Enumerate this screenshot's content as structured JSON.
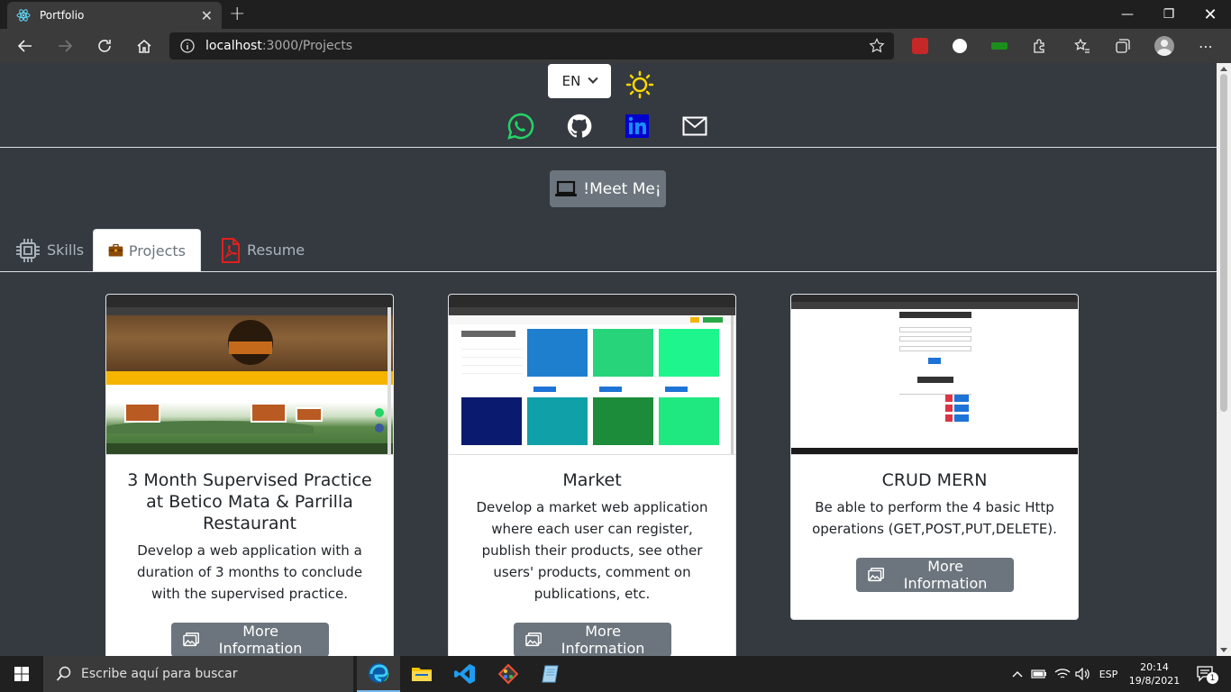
{
  "browser": {
    "tab_title": "Portfolio",
    "url_host": "localhost",
    "url_path": ":3000/Projects"
  },
  "header": {
    "language": "EN",
    "social": [
      "whatsapp-icon",
      "github-icon",
      "linkedin-icon",
      "mail-icon"
    ]
  },
  "meet_button": "!Meet Me¡",
  "tabs": [
    {
      "label": "Skills",
      "icon": "chip-icon"
    },
    {
      "label": "Projects",
      "icon": "briefcase-icon"
    },
    {
      "label": "Resume",
      "icon": "pdf-icon"
    }
  ],
  "projects": [
    {
      "title": "3 Month Supervised Practice at Betico Mata & Parrilla Restaurant",
      "description": "Develop a web application with a duration of 3 months to conclude with the supervised practice.",
      "button": "More Information"
    },
    {
      "title": "Market",
      "description": "Develop a market web application where each user can register, publish their products, see other users' products, comment on publications, etc.",
      "button": "More Information"
    },
    {
      "title": "CRUD MERN",
      "description": "Be able to perform the 4 basic Http operations (GET,POST,PUT,DELETE).",
      "button": "More Information"
    }
  ],
  "taskbar": {
    "search_placeholder": "Escribe aquí para buscar",
    "language": "ESP",
    "time": "20:14",
    "date": "19/8/2021",
    "notifications": "1"
  },
  "colors": {
    "page_bg": "#343a40",
    "button_gray": "#6c757d",
    "sun_yellow": "#ffd800"
  }
}
